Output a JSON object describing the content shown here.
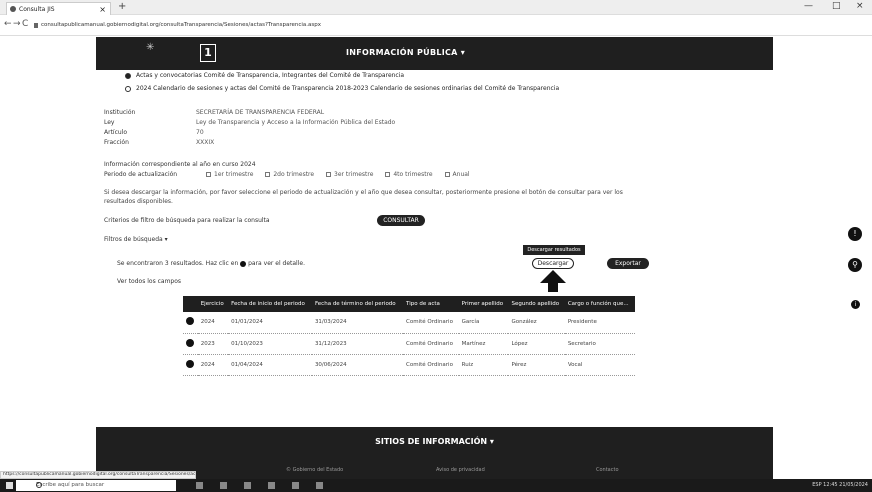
{
  "browser": {
    "tab_title": "Consulta JIS",
    "tab_close": "×",
    "new_tab": "+",
    "url": "consultapublicamanual.gobiernodigital.org/consultaTransparencia/Sesiones/actas?Transparencia.aspx",
    "controls": {
      "minimize": "—",
      "maximize": "□",
      "close": "×"
    },
    "nav": {
      "back": "←",
      "forward": "→",
      "reload": "C"
    }
  },
  "header": {
    "logo_glyph": "✳",
    "number_badge": "1",
    "title": "INFORMACIÓN PÚBLICA ▾"
  },
  "options": [
    {
      "text": "Actas y convocatorias Comité de Transparencia, Integrantes del Comité de Transparencia",
      "selected": true
    },
    {
      "text": "2024 Calendario de sesiones y actas del Comité de Transparencia 2018-2023 Calendario de sesiones ordinarias del Comité de Transparencia",
      "selected": false
    }
  ],
  "fields": [
    {
      "label": "Institución",
      "value": "SECRETARÍA DE TRANSPARENCIA FEDERAL"
    },
    {
      "label": "Ley",
      "value": "Ley de Transparencia y Acceso a la Información Pública del Estado"
    },
    {
      "label": "Artículo",
      "value": "70"
    },
    {
      "label": "Fracción",
      "value": "XXXIX"
    }
  ],
  "period_heading": "Información correspondiente al año en curso 2024",
  "period_label": "Periodo de actualización",
  "period_options": [
    "1er trimestre",
    "2do trimestre",
    "3er trimestre",
    "4to trimestre",
    "Anual"
  ],
  "help_text": "Si desea descargar la información, por favor seleccione el periodo de actualización y el año que desea consultar, posteriormente presione el botón de consultar para ver los resultados disponibles.",
  "search_label": "Criterios de filtro de búsqueda para realizar la consulta",
  "consult_button": "CONSULTAR",
  "filters_link": "Filtros de búsqueda ▾",
  "results_info": "Se encontraron 3 resultados. Haz clic en",
  "results_info_tail": "para ver el detalle.",
  "see_all": "Ver todos los campos",
  "tooltip": "Descargar resultados",
  "download_button": "Descargar",
  "export_button": "Exportar",
  "table": {
    "headers": [
      "",
      "Ejercicio",
      "Fecha de inicio del periodo",
      "Fecha de término del periodo",
      "Tipo de acta",
      "Primer apellido",
      "Segundo apellido",
      "Cargo o función que..."
    ],
    "rows": [
      [
        "",
        "2024",
        "01/01/2024",
        "31/03/2024",
        "Comité Ordinario",
        "García",
        "González",
        "Presidente"
      ],
      [
        "",
        "2023",
        "01/10/2023",
        "31/12/2023",
        "Comité Ordinario",
        "Martínez",
        "López",
        "Secretario"
      ],
      [
        "",
        "2024",
        "01/04/2024",
        "30/06/2024",
        "Comité Ordinario",
        "Ruiz",
        "Pérez",
        "Vocal"
      ]
    ]
  },
  "footer": {
    "title": "SITIOS DE INFORMACIÓN ▾",
    "line1": "© Gobierno del Estado",
    "line2": "Aviso de privacidad",
    "line3": "Contacto"
  },
  "status_url": "https://consultapublicamanual.gobiernodigital.org/consultaTransparencia/Sesiones/actas",
  "side_icons": [
    "!",
    "⚲",
    "i"
  ],
  "taskbar": {
    "search_placeholder": "Escribe aquí para buscar",
    "tray": "ESP  12:45  21/05/2024"
  }
}
